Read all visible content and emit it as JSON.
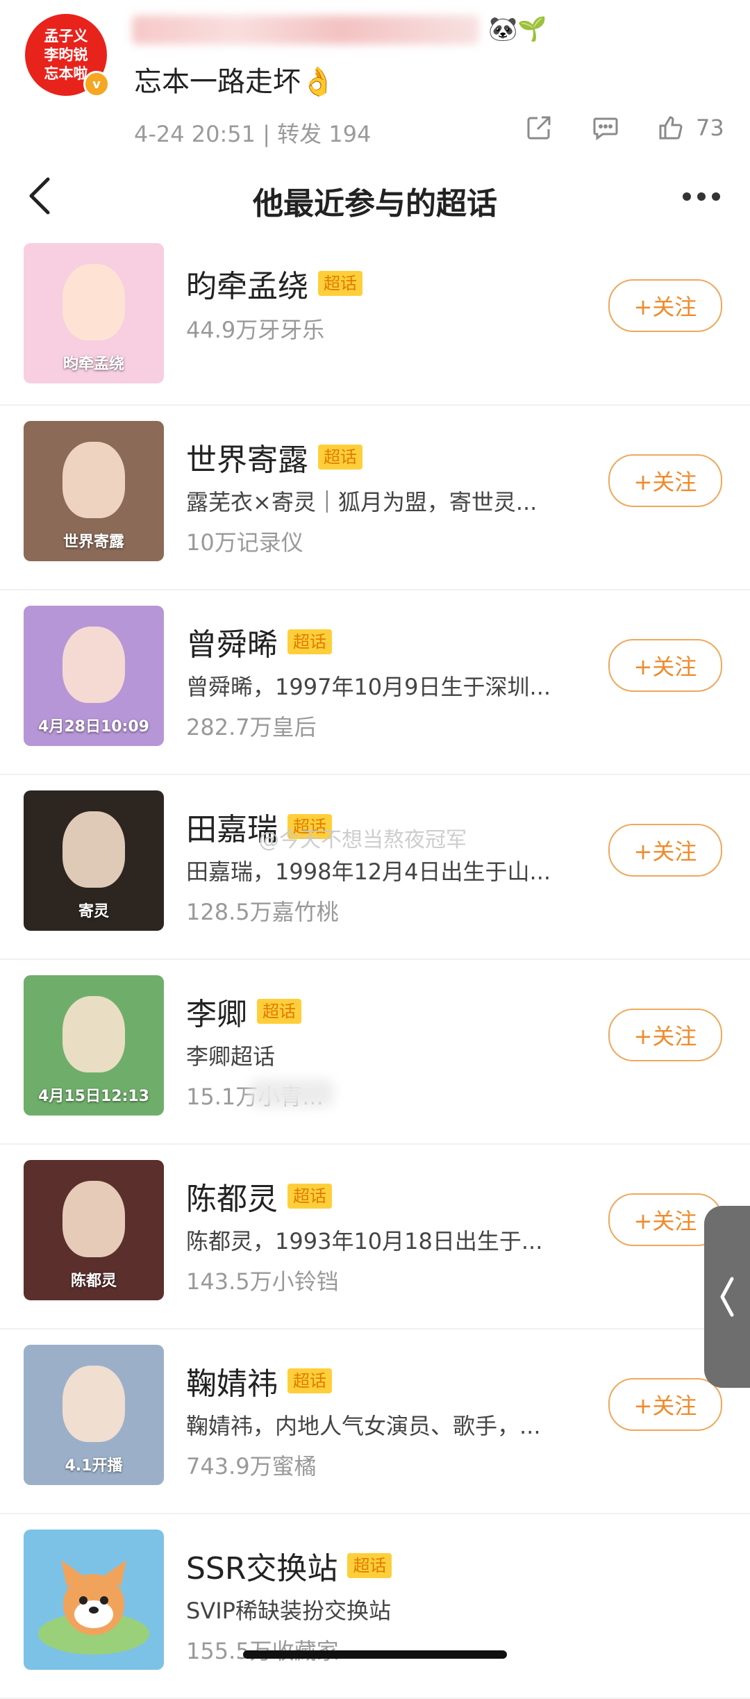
{
  "post": {
    "avatar_lines": [
      "孟子义",
      "李昀锐",
      "忘本啦"
    ],
    "vip_badge": "v",
    "emoji": "🐼🌱",
    "text": "忘本一路走坏👌",
    "meta": "4-24 20:51 | 转发 194",
    "share_icon": "share-icon",
    "comment_icon": "comment-icon",
    "like_icon": "thumbs-up-icon",
    "like_count": "73"
  },
  "titlebar": {
    "title": "他最近参与的超话",
    "back_icon": "chevron-left-icon",
    "more_icon": "more-dots-icon"
  },
  "items": [
    {
      "name": "昀牵孟绕",
      "tag": "超话",
      "desc": "",
      "fans": "44.9万牙牙乐",
      "follow": "+关注",
      "thumb_text": "昀牵孟绕",
      "thumb_color": "#f7cfe0"
    },
    {
      "name": "世界寄露",
      "tag": "超话",
      "desc": "露芜衣×寄灵｜狐月为盟，寄世灵...",
      "fans": "10万记录仪",
      "follow": "+关注",
      "thumb_text": "世界寄露",
      "thumb_color": "#8b6a58"
    },
    {
      "name": "曾舜晞",
      "tag": "超话",
      "desc": "曾舜晞，1997年10月9日生于深圳...",
      "fans": "282.7万皇后",
      "follow": "+关注",
      "thumb_text": "4月28日10:09",
      "thumb_color": "#b696d6"
    },
    {
      "name": "田嘉瑞",
      "tag": "超话",
      "desc": "田嘉瑞，1998年12月4日出生于山...",
      "fans": "128.5万嘉竹桃",
      "follow": "+关注",
      "thumb_text": "寄灵",
      "thumb_color": "#2c2520"
    },
    {
      "name": "李卿",
      "tag": "超话",
      "desc": "李卿超话",
      "fans": "15.1万小青...",
      "follow": "+关注",
      "thumb_text": "4月15日12:13",
      "thumb_color": "#6fae6a"
    },
    {
      "name": "陈都灵",
      "tag": "超话",
      "desc": "陈都灵，1993年10月18日出生于...",
      "fans": "143.5万小铃铛",
      "follow": "+关注",
      "thumb_text": "陈都灵",
      "thumb_color": "#5a2f2c"
    },
    {
      "name": "鞠婧祎",
      "tag": "超话",
      "desc": "鞠婧祎，内地人气女演员、歌手，...",
      "fans": "743.9万蜜橘",
      "follow": "+关注",
      "thumb_text": "4.1开播",
      "thumb_color": "#9bb0c8"
    },
    {
      "name": "SSR交换站",
      "tag": "超话",
      "desc": "SVIP稀缺装扮交换站",
      "fans": "155.5万收藏家",
      "follow": "+关注",
      "thumb_text": "",
      "thumb_color": "#7cc2e6"
    }
  ],
  "watermark": "@今天不想当熬夜冠军",
  "colors": {
    "accent": "#f08a2a",
    "tag_bg": "#ffcf3b",
    "avatar_bg": "#e8231c"
  }
}
